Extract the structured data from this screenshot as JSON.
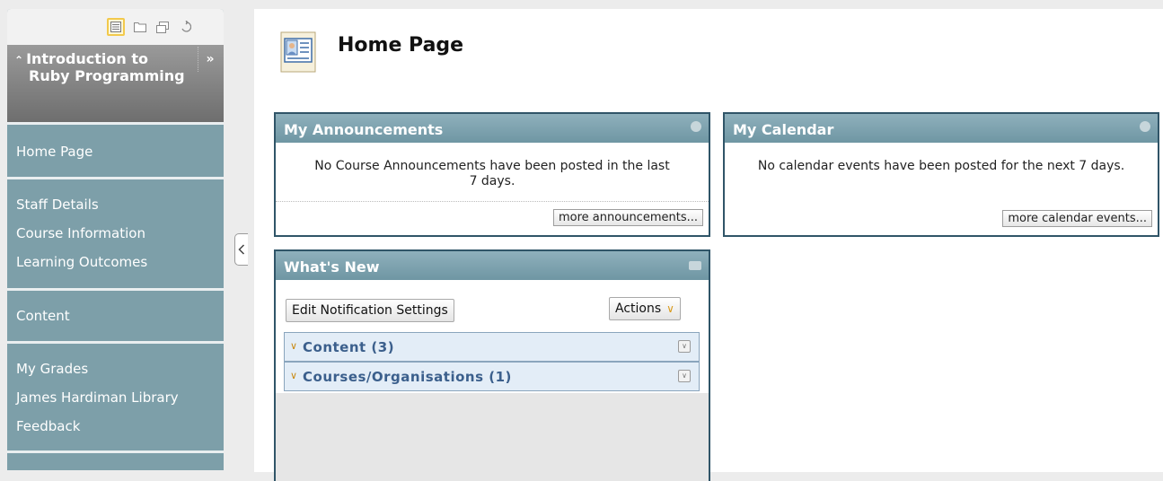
{
  "sidebar": {
    "toolbar_icons": [
      "list-icon",
      "folder-icon",
      "window-icon",
      "refresh-icon"
    ],
    "course": {
      "collapse_glyph": "»",
      "expand_glyph": "»",
      "title": "Introduction to Ruby Programming"
    },
    "groups": [
      {
        "items": [
          "Home Page"
        ]
      },
      {
        "items": [
          "Staff Details",
          "Course Information",
          "Learning Outcomes"
        ]
      },
      {
        "items": [
          "Content"
        ]
      },
      {
        "items": [
          "My Grades",
          "James Hardiman Library",
          "Feedback"
        ]
      }
    ]
  },
  "main": {
    "title": "Home Page",
    "announcements": {
      "title": "My Announcements",
      "message": "No Course Announcements have been posted in the last 7 days.",
      "more_label": "more announcements..."
    },
    "calendar": {
      "title": "My Calendar",
      "message": "No calendar events have been posted for the next 7 days.",
      "more_label": "more calendar events..."
    },
    "whats_new": {
      "title": "What's New",
      "edit_label": "Edit Notification Settings",
      "actions_label": "Actions",
      "rows": [
        {
          "label": "Content (3)"
        },
        {
          "label": "Courses/Organisations (1)"
        }
      ]
    }
  },
  "colors": {
    "sidebar": "#7d9fa9",
    "module_header": "#7a9faa",
    "module_border": "#305568",
    "row_bg": "#e3edf7",
    "row_text": "#3b5f8c"
  }
}
